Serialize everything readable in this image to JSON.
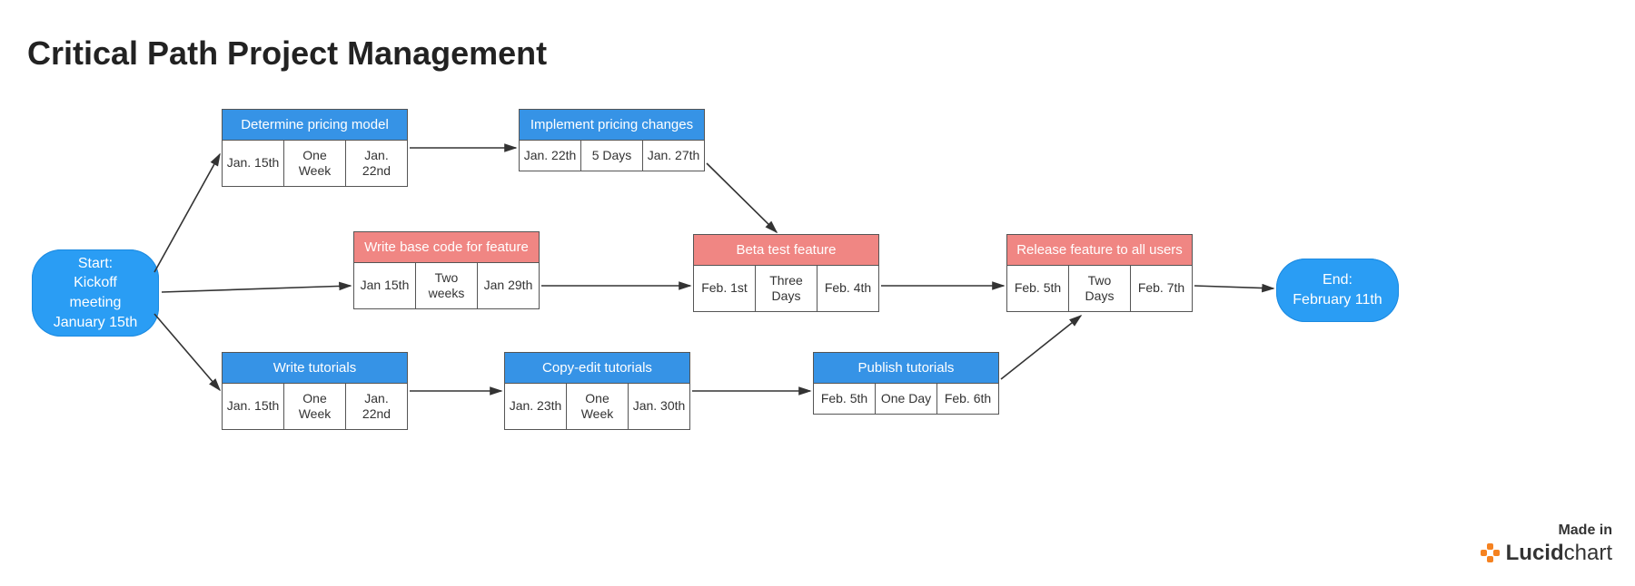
{
  "title": "Critical Path Project Management",
  "start": {
    "line1": "Start:",
    "line2": "Kickoff meeting",
    "line3": "January 15th"
  },
  "end": {
    "line1": "End:",
    "line2": "February 11th"
  },
  "tasks": {
    "pricing_model": {
      "title": "Determine pricing model",
      "start": "Jan. 15th",
      "dur": "One Week",
      "finish": "Jan. 22nd",
      "color": "blue"
    },
    "pricing_changes": {
      "title": "Implement pricing changes",
      "start": "Jan. 22th",
      "dur": "5 Days",
      "finish": "Jan. 27th",
      "color": "blue"
    },
    "base_code": {
      "title": "Write base code for feature",
      "start": "Jan 15th",
      "dur": "Two weeks",
      "finish": "Jan 29th",
      "color": "red"
    },
    "beta_test": {
      "title": "Beta test feature",
      "start": "Feb. 1st",
      "dur": "Three Days",
      "finish": "Feb. 4th",
      "color": "red"
    },
    "release": {
      "title": "Release feature to all users",
      "start": "Feb. 5th",
      "dur": "Two Days",
      "finish": "Feb. 7th",
      "color": "red"
    },
    "write_tut": {
      "title": "Write tutorials",
      "start": "Jan. 15th",
      "dur": "One Week",
      "finish": "Jan. 22nd",
      "color": "blue"
    },
    "copyedit": {
      "title": "Copy-edit tutorials",
      "start": "Jan. 23th",
      "dur": "One Week",
      "finish": "Jan. 30th",
      "color": "blue"
    },
    "publish": {
      "title": "Publish tutorials",
      "start": "Feb. 5th",
      "dur": "One Day",
      "finish": "Feb. 6th",
      "color": "blue"
    }
  },
  "attribution": {
    "madein": "Made in",
    "brand_bold": "Lucid",
    "brand_rest": "chart"
  }
}
